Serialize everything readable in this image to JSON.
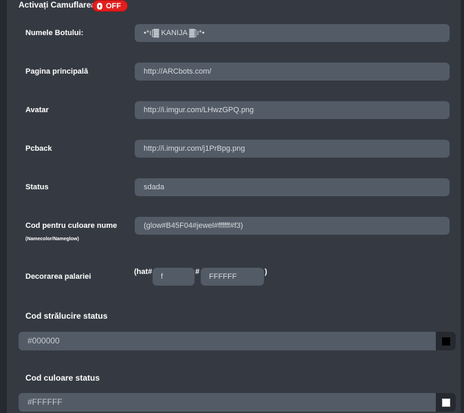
{
  "camouflage": {
    "label": "Activați Camuflarea?",
    "toggle_text": "OFF",
    "enabled": false
  },
  "fields": [
    {
      "label": "Numele Botului:",
      "value": "•*ı[▓ KANIJA ▓]ı*•"
    },
    {
      "label": "Pagina principală",
      "value": "http://ARCbots.com/"
    },
    {
      "label": "Avatar",
      "value": "http://i.imgur.com/LHwzGPQ.png"
    },
    {
      "label": "Pcback",
      "value": "http://i.imgur.com/j1PrBpg.png"
    },
    {
      "label": "Status",
      "value": "sdada"
    },
    {
      "label": "Cod pentru culoare nume",
      "sublabel": "(Namecolor/Nameglow)",
      "value": "(glow#B45F04#jewel#ffffff#f3)"
    }
  ],
  "hat": {
    "label": "Decorarea palariei",
    "prefix": "(hat#",
    "value1": "f",
    "separator": "#",
    "value2": "FFFFFF",
    "suffix": ")"
  },
  "status_glow": {
    "label": "Cod strălucire status",
    "value": "#000000",
    "swatch_color": "#000000"
  },
  "status_color": {
    "label": "Cod culoare status",
    "value": "#FFFFFF",
    "swatch_color": "#FFFFFF"
  }
}
